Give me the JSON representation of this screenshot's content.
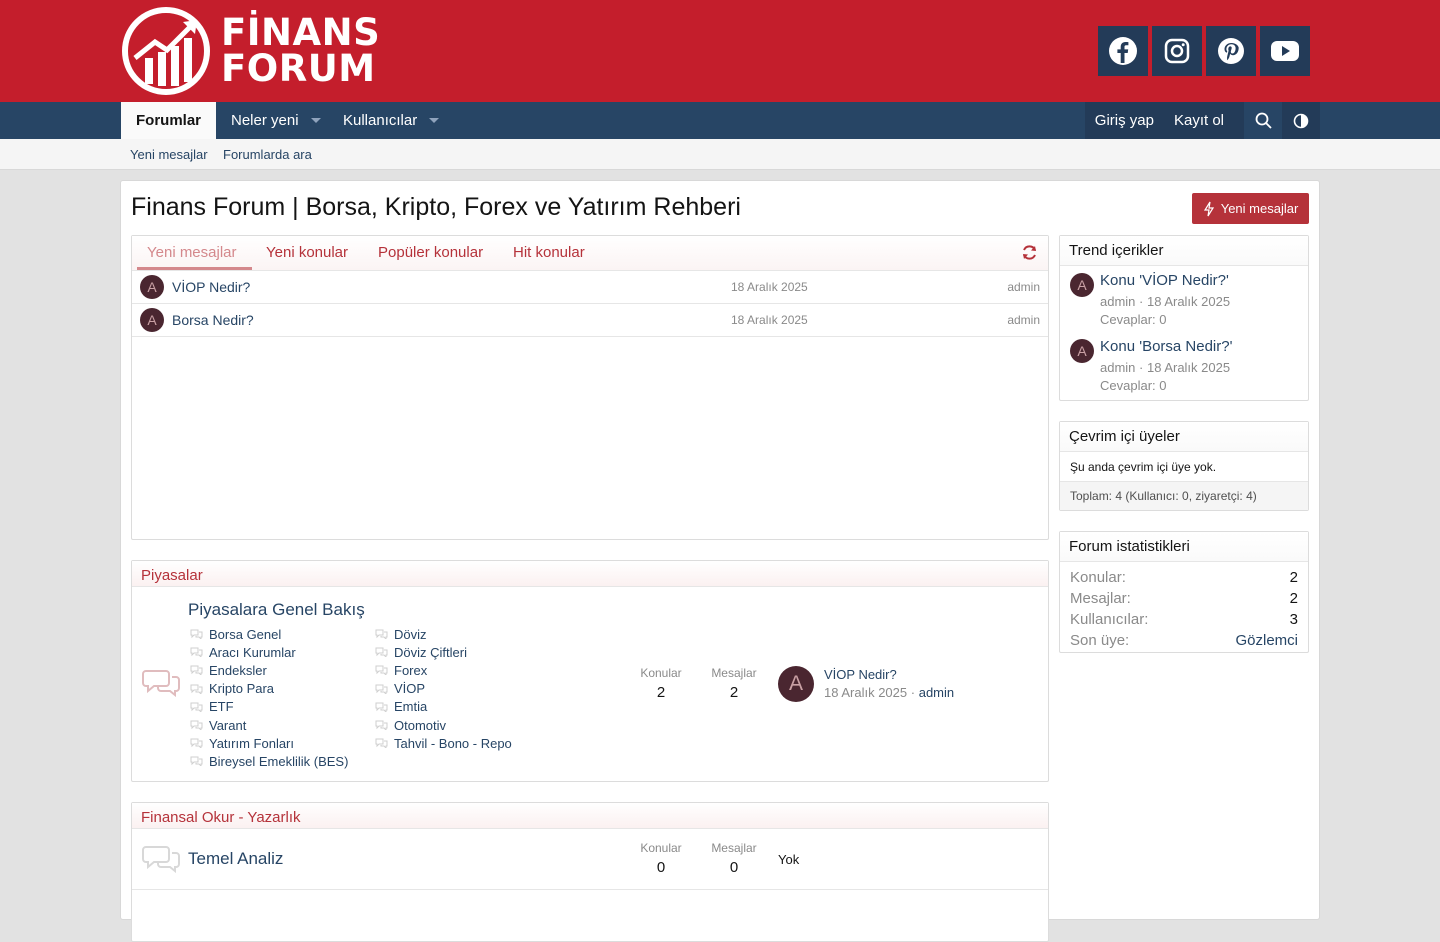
{
  "site": {
    "logo_line1": "FİNANS",
    "logo_line2": "FORUM",
    "social_icons": [
      "facebook-icon",
      "instagram-icon",
      "pinterest-icon",
      "youtube-icon"
    ]
  },
  "nav": {
    "tabs": [
      {
        "label": "Forumlar"
      },
      {
        "label": "Neler yeni"
      },
      {
        "label": "Kullanıcılar"
      }
    ],
    "login": "Giriş yap",
    "register": "Kayıt ol"
  },
  "subnav": {
    "items": [
      "Yeni mesajlar",
      "Forumlarda ara"
    ]
  },
  "page": {
    "title": "Finans Forum | Borsa, Kripto, Forex ve Yatırım Rehberi",
    "new_posts_button": "Yeni mesajlar"
  },
  "tabs": {
    "items": [
      "Yeni mesajlar",
      "Yeni konular",
      "Popüler konular",
      "Hit konular"
    ],
    "threads": [
      {
        "avatar": "A",
        "title": "VİOP Nedir?",
        "date": "18 Aralık 2025",
        "author": "admin"
      },
      {
        "avatar": "A",
        "title": "Borsa Nedir?",
        "date": "18 Aralık 2025",
        "author": "admin"
      }
    ]
  },
  "categories": [
    {
      "title": "Piyasalar",
      "node": {
        "title": "Piyasalara Genel Bakış",
        "subforums_col1": [
          "Borsa Genel",
          "Aracı Kurumlar",
          "Endeksler",
          "Kripto Para",
          "ETF",
          "Varant",
          "Yatırım Fonları",
          "Bireysel Emeklilik (BES)"
        ],
        "subforums_col2": [
          "Döviz",
          "Döviz Çiftleri",
          "Forex",
          "VİOP",
          "Emtia",
          "Otomotiv",
          "Tahvil - Bono - Repo"
        ],
        "threads_label": "Konular",
        "threads": "2",
        "messages_label": "Mesajlar",
        "messages": "2",
        "last_avatar": "A",
        "last_title": "VİOP Nedir?",
        "last_date": "18 Aralık 2025",
        "last_sep": "·",
        "last_user": "admin"
      }
    },
    {
      "title": "Finansal Okur - Yazarlık",
      "node": {
        "title": "Temel Analiz",
        "threads_label": "Konular",
        "threads": "0",
        "messages_label": "Mesajlar",
        "messages": "0",
        "last": "Yok"
      }
    }
  ],
  "sidebar": {
    "trending": {
      "title": "Trend içerikler",
      "items": [
        {
          "avatar": "A",
          "title": "Konu 'VİOP Nedir?'",
          "meta": "admin · 18 Aralık 2025",
          "replies": "Cevaplar: 0"
        },
        {
          "avatar": "A",
          "title": "Konu 'Borsa Nedir?'",
          "meta": "admin · 18 Aralık 2025",
          "replies": "Cevaplar: 0"
        }
      ]
    },
    "online": {
      "title": "Çevrim içi üyeler",
      "body": "Şu anda çevrim içi üye yok.",
      "footer": "Toplam: 4 (Kullanıcı: 0, ziyaretçi: 4)"
    },
    "stats": {
      "title": "Forum istatistikleri",
      "rows": [
        {
          "k": "Konular:",
          "v": "2"
        },
        {
          "k": "Mesajlar:",
          "v": "2"
        },
        {
          "k": "Kullanıcılar:",
          "v": "3"
        },
        {
          "k": "Son üye:",
          "v": "Gözlemci"
        }
      ]
    }
  },
  "colors": {
    "brand_red": "#c41e2c",
    "nav_blue": "#274565",
    "accent": "#b5323a"
  }
}
